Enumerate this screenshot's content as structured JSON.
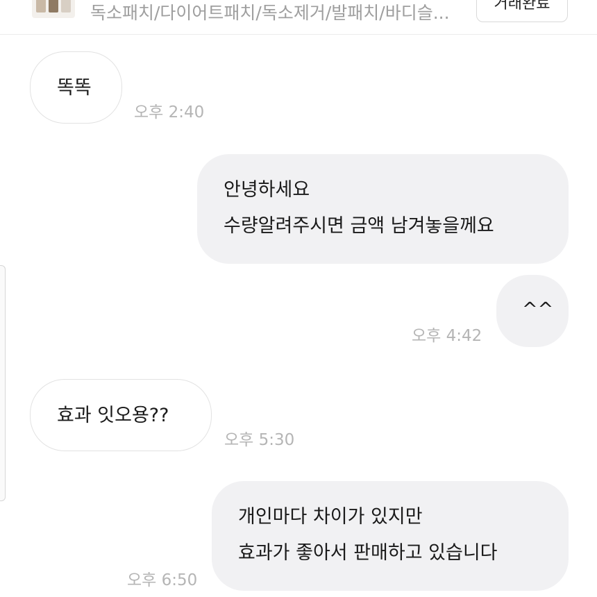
{
  "header": {
    "product_title": "독소패치/다이어트패치/독소제거/발패치/바디슬...",
    "action_button_label": "거래완료"
  },
  "messages": [
    {
      "direction": "in",
      "lines": [
        "똑똑"
      ],
      "time": "오후 2:40"
    },
    {
      "direction": "out",
      "lines": [
        "안녕하세요",
        "수량알려주시면 금액 남겨놓을께요"
      ],
      "time": ""
    },
    {
      "direction": "out",
      "lines": [
        "^^"
      ],
      "time": "오후 4:42"
    },
    {
      "direction": "in",
      "lines": [
        "효과 잇오용??"
      ],
      "time": "오후 5:30"
    },
    {
      "direction": "out",
      "lines": [
        "개인마다 차이가 있지만",
        "효과가 좋아서 판매하고 있습니다"
      ],
      "time": "오후 6:50"
    }
  ]
}
